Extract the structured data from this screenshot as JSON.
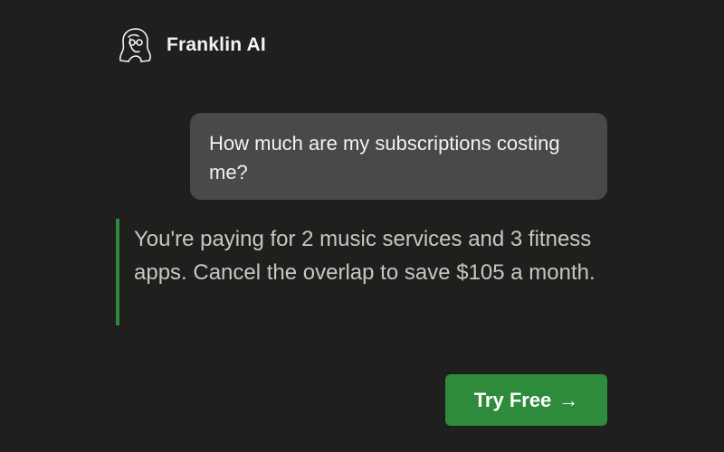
{
  "header": {
    "logo_icon": "franklin-head-icon",
    "brand_name": "Franklin AI"
  },
  "conversation": {
    "user_message": "How much are my subscriptions costing me?",
    "assistant_message": "You're paying for 2 music services and 3 fitness apps. Cancel the overlap to save $105 a month."
  },
  "cta": {
    "label": "Try Free",
    "arrow": "→",
    "arrow_icon": "arrow-right-icon"
  },
  "colors": {
    "background": "#1f201e",
    "accent_green": "#2e8b3b",
    "user_bubble": "#484948",
    "response_text": "#c6c6c2"
  }
}
